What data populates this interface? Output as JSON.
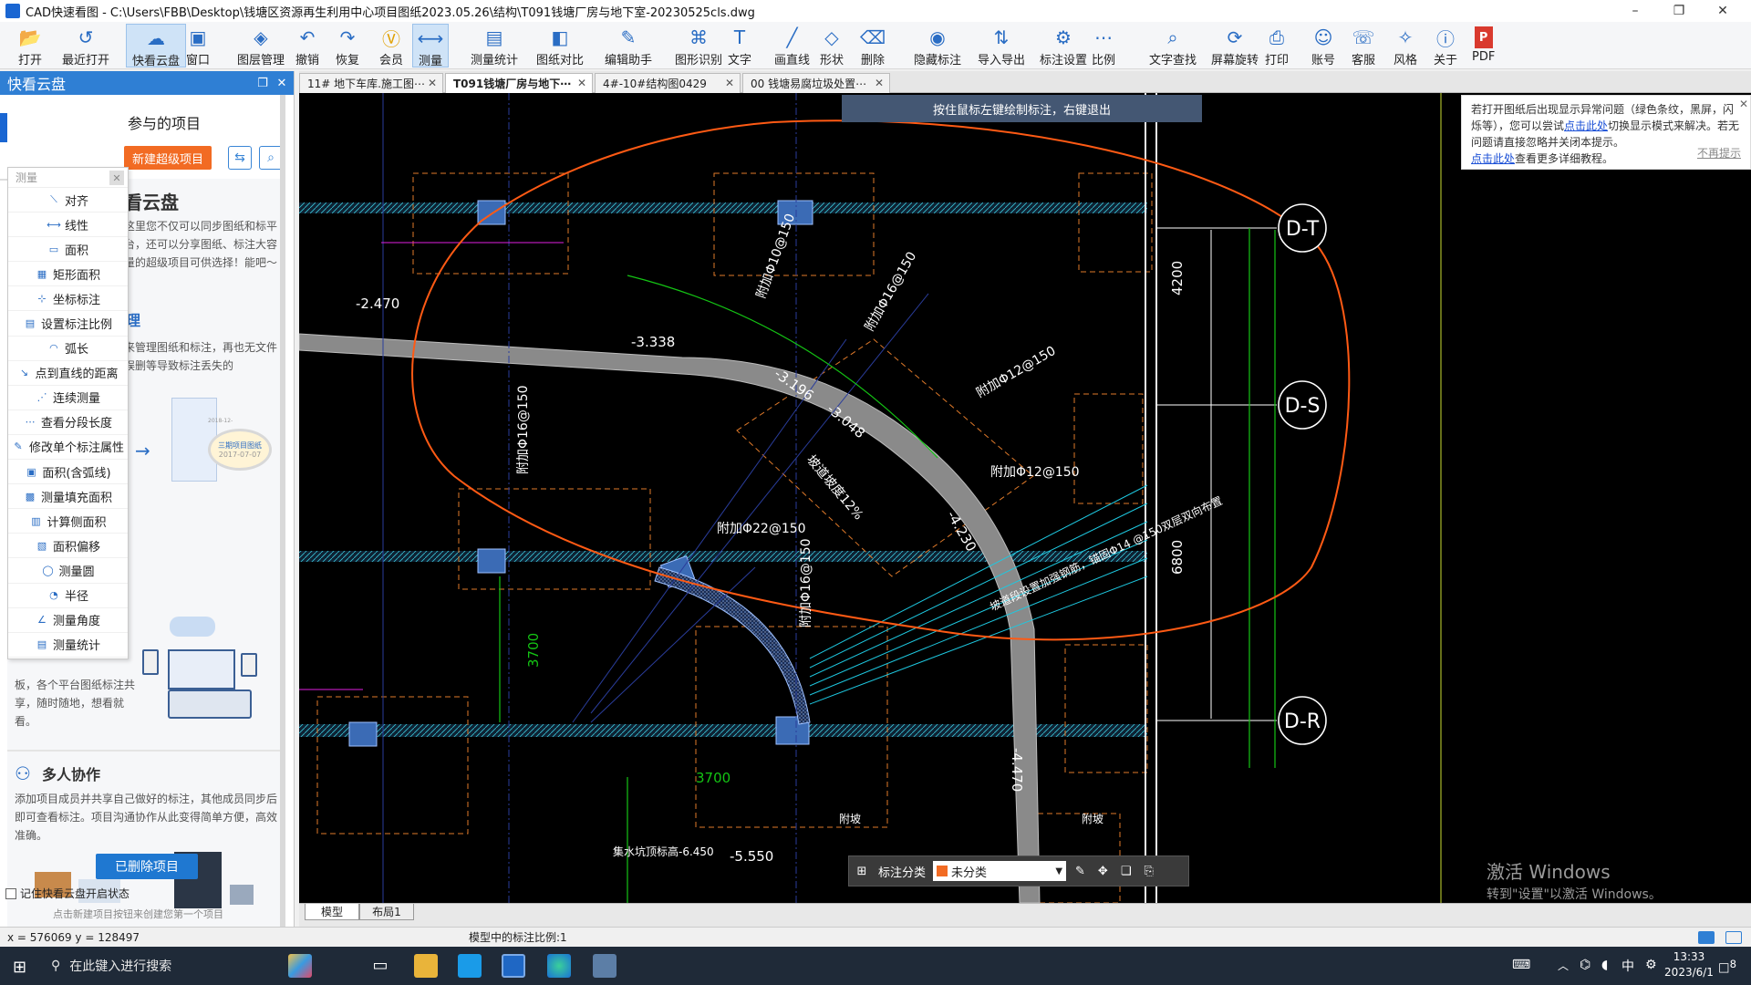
{
  "window": {
    "title": "CAD快速看图 - C:\\Users\\FBB\\Desktop\\钱塘区资源再生利用中心项目图纸2023.05.26\\结构\\T091钱塘厂房与地下室-20230525cls.dwg",
    "min": "–",
    "max": "❐",
    "close": "✕"
  },
  "toolbar": {
    "items": [
      {
        "label": "打开",
        "icon": "folder-open-icon"
      },
      {
        "label": "最近打开",
        "icon": "recent-icon"
      },
      {
        "label": "快看云盘",
        "icon": "cloud-icon",
        "active": true
      },
      {
        "label": "窗口",
        "icon": "window-icon"
      },
      {
        "label": "图层管理",
        "icon": "layers-icon"
      },
      {
        "label": "撤销",
        "icon": "undo-icon"
      },
      {
        "label": "恢复",
        "icon": "redo-icon"
      },
      {
        "label": "会员",
        "icon": "vip-icon"
      },
      {
        "label": "测量",
        "icon": "measure-icon",
        "active": true
      },
      {
        "label": "测量统计",
        "icon": "measure-stats-icon"
      },
      {
        "label": "图纸对比",
        "icon": "compare-icon"
      },
      {
        "label": "编辑助手",
        "icon": "edit-assistant-icon"
      },
      {
        "label": "图形识别",
        "icon": "shape-recognize-icon"
      },
      {
        "label": "文字",
        "icon": "text-icon"
      },
      {
        "label": "画直线",
        "icon": "line-icon"
      },
      {
        "label": "形状",
        "icon": "shape-icon"
      },
      {
        "label": "删除",
        "icon": "eraser-icon"
      },
      {
        "label": "隐藏标注",
        "icon": "hide-annotation-icon"
      },
      {
        "label": "导入导出",
        "icon": "import-export-icon"
      },
      {
        "label": "标注设置",
        "icon": "annotation-settings-icon"
      },
      {
        "label": "比例",
        "icon": "scale-icon"
      },
      {
        "label": "文字查找",
        "icon": "text-search-icon"
      },
      {
        "label": "屏幕旋转",
        "icon": "rotate-screen-icon"
      },
      {
        "label": "打印",
        "icon": "print-icon"
      },
      {
        "label": "账号",
        "icon": "account-icon"
      },
      {
        "label": "客服",
        "icon": "support-icon"
      },
      {
        "label": "风格",
        "icon": "style-icon"
      },
      {
        "label": "关于",
        "icon": "about-icon"
      },
      {
        "label": "PDF",
        "icon": "pdf-icon"
      }
    ]
  },
  "left_panel": {
    "title": "快看云盘",
    "participated_projects": "参与的项目",
    "new_super_project": "新建超级项目",
    "cloud_title": "看云盘",
    "cloud_desc": "这里您不仅可以同步图纸和标平台，还可以分享图纸、标注大容量的超级项目可供选择！能吧～",
    "manage_title": "理",
    "manage_desc": "来管理图纸和标注，再也无文件误删等导致标注丢失的",
    "share_desc": "板，各个平台图纸标注共享，随时随地，想看就看。",
    "collab_title": "多人协作",
    "collab_desc": "添加项目成员并共享自己做好的标注，其他成员同步后即可查看标注。项目沟通协作从此变得简单方便，高效准确。",
    "deleted_projects": "已删除项目",
    "remember_label": "记住快看云盘开启状态",
    "hint": "点击新建项目按钮来创建您第一个项目",
    "thumb_date1": "2018-12-",
    "thumb_folder": "三期项目图纸",
    "thumb_date2": "2017-07-07"
  },
  "measure_menu": {
    "header": "测量",
    "items": [
      "对齐",
      "线性",
      "面积",
      "矩形面积",
      "坐标标注",
      "设置标注比例",
      "弧长",
      "点到直线的距离",
      "连续测量",
      "查看分段长度",
      "修改单个标注属性",
      "面积(含弧线)",
      "测量填充面积",
      "计算侧面积",
      "面积偏移",
      "测量圆",
      "半径",
      "测量角度",
      "测量统计"
    ]
  },
  "tabs": [
    {
      "label": "11# 地下车库.施工图⋯",
      "active": false
    },
    {
      "label": "T091钱塘厂房与地下⋯",
      "active": true
    },
    {
      "label": "4#-10#结构图0429",
      "active": false
    },
    {
      "label": "00 钱塘易腐垃圾处置⋯",
      "active": false
    }
  ],
  "canvas": {
    "hint": "按住鼠标左键绘制标注，右键退出",
    "notice": {
      "line1": "若打开图纸后出现显示异常问题（绿色条纹，黑屏，闪烁等），您可以尝试",
      "link1": "点击此处",
      "line1b": "切换显示模式来解决。若无问题请直接忽略并关闭本提示。",
      "link2": "点击此处",
      "line2": "查看更多详细教程。",
      "dismiss": "不再提示"
    },
    "axes": [
      "D-T",
      "D-S",
      "D-R"
    ],
    "dims": [
      "-2.470",
      "-3.338",
      "-3.196",
      "-3.048",
      "-4.230",
      "-5.550",
      "-4.470",
      "4200",
      "6800",
      "3700",
      "3700"
    ],
    "rebar": [
      "附加Φ10@150",
      "附加Φ16@150",
      "附加Φ16@150",
      "附加Φ12@150",
      "附加Φ22@150",
      "附加Φ16@150",
      "附加Φ12@150",
      "坡道坡度12%",
      "坡道段设置加强钢筋，锚固Φ14 @150双层双向布置",
      "集水坑顶标高-6.450",
      "附坡",
      "附坡"
    ],
    "bottom_tabs": [
      "模型",
      "布局1"
    ],
    "float_toolbar": {
      "label": "标注分类",
      "select": "未分类"
    },
    "watermark1": "激活 Windows",
    "watermark2": "转到\"设置\"以激活 Windows。"
  },
  "status": {
    "coords": "x = 576069  y = 128497",
    "scale": "模型中的标注比例:1"
  },
  "taskbar": {
    "search": "在此键入进行搜索",
    "time": "13:33",
    "date": "2023/6/1",
    "ime": "中",
    "notif": "8"
  }
}
